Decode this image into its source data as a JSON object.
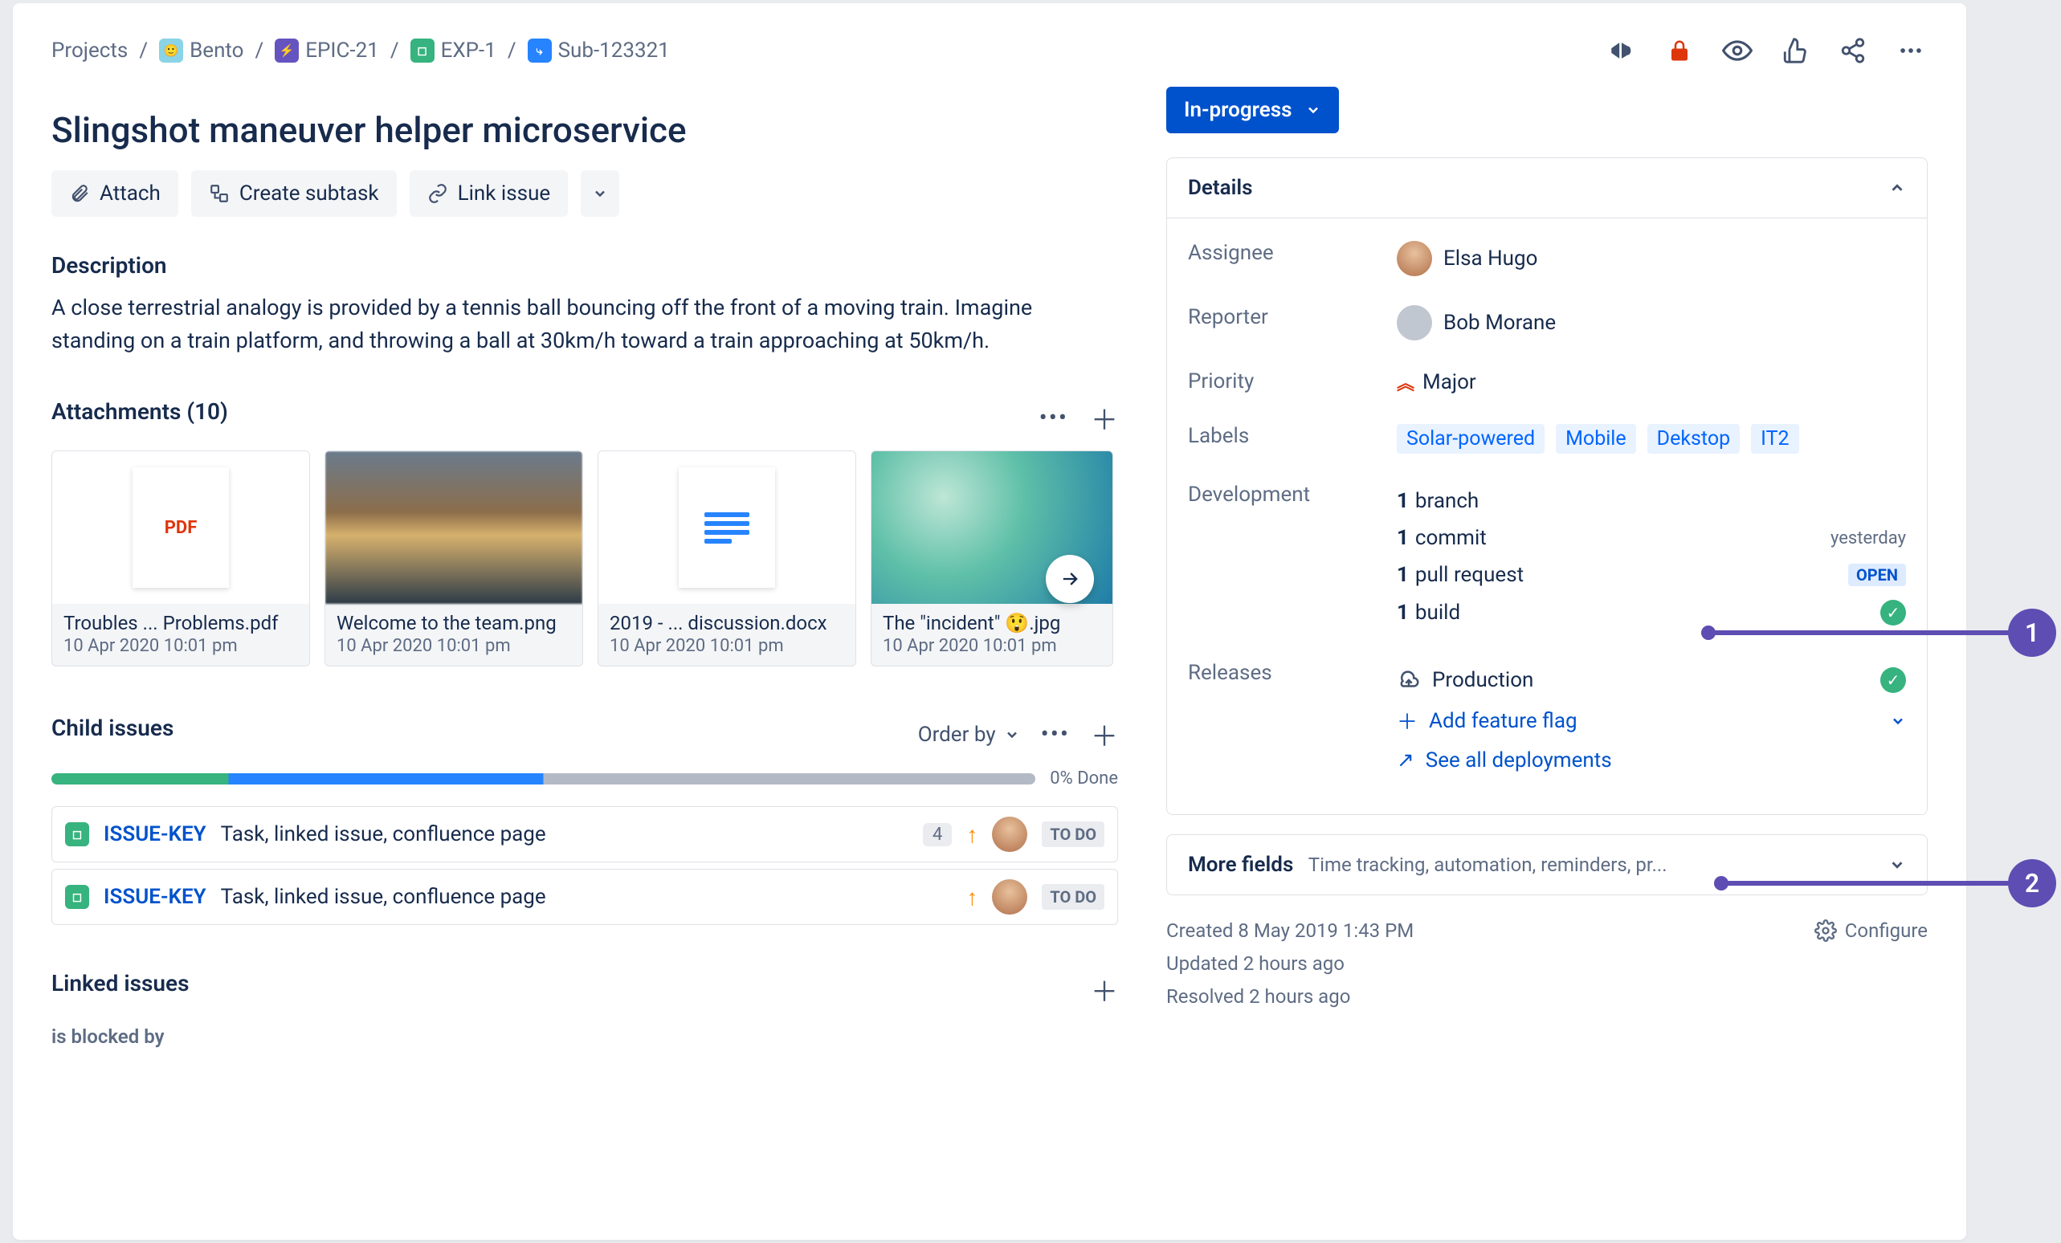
{
  "breadcrumbs": {
    "root": "Projects",
    "project": "Bento",
    "epic": "EPIC-21",
    "exp": "EXP-1",
    "sub": "Sub-123321"
  },
  "issue": {
    "title": "Slingshot maneuver helper microservice",
    "actions": {
      "attach": "Attach",
      "create_subtask": "Create subtask",
      "link_issue": "Link issue"
    },
    "description_heading": "Description",
    "description": "A close terrestrial analogy is provided by a tennis ball bouncing off the front of a moving train. Imagine standing on a train platform, and throwing a ball at 30km/h toward a train approaching at 50km/h."
  },
  "attachments": {
    "heading": "Attachments (10)",
    "items": [
      {
        "name": "Troubles ... Problems.pdf",
        "date": "10 Apr 2020 10:01 pm",
        "kind": "pdf",
        "pdf_label": "PDF"
      },
      {
        "name": "Welcome to the team.png",
        "date": "10 Apr 2020 10:01 pm",
        "kind": "img1"
      },
      {
        "name": "2019 - ... discussion.docx",
        "date": "10 Apr 2020 10:01 pm",
        "kind": "doc"
      },
      {
        "name": "The \"incident\" 😲.jpg",
        "date": "10 Apr 2020 10:01 pm",
        "kind": "img2"
      }
    ]
  },
  "child_issues": {
    "heading": "Child issues",
    "order_by": "Order by",
    "done_label": "0% Done",
    "rows": [
      {
        "key": "ISSUE-KEY",
        "summary": "Task, linked issue, confluence page",
        "count": "4",
        "status": "TO DO"
      },
      {
        "key": "ISSUE-KEY",
        "summary": "Task, linked issue, confluence page",
        "count": "",
        "status": "TO DO"
      }
    ]
  },
  "linked": {
    "heading": "Linked issues",
    "relation": "is blocked by"
  },
  "status": {
    "label": "In-progress"
  },
  "details": {
    "heading": "Details",
    "assignee_label": "Assignee",
    "assignee": "Elsa Hugo",
    "reporter_label": "Reporter",
    "reporter": "Bob Morane",
    "priority_label": "Priority",
    "priority": "Major",
    "labels_label": "Labels",
    "labels": [
      "Solar-powered",
      "Mobile",
      "Dekstop",
      "IT2"
    ],
    "development_label": "Development",
    "development": {
      "branch": {
        "n": "1",
        "word": "branch"
      },
      "commit": {
        "n": "1",
        "word": "commit",
        "when": "yesterday"
      },
      "pr": {
        "n": "1",
        "word": "pull request",
        "badge": "OPEN"
      },
      "build": {
        "n": "1",
        "word": "build"
      }
    },
    "releases_label": "Releases",
    "releases": {
      "env": "Production",
      "add_flag": "Add feature flag",
      "see_all": "See all deployments"
    }
  },
  "more_fields": {
    "heading": "More fields",
    "hint": "Time tracking, automation, reminders, pr..."
  },
  "meta": {
    "created": "Created 8 May 2019 1:43 PM",
    "updated": "Updated 2 hours ago",
    "resolved": "Resolved 2 hours ago",
    "configure": "Configure"
  },
  "annotations": {
    "one": "1",
    "two": "2"
  }
}
